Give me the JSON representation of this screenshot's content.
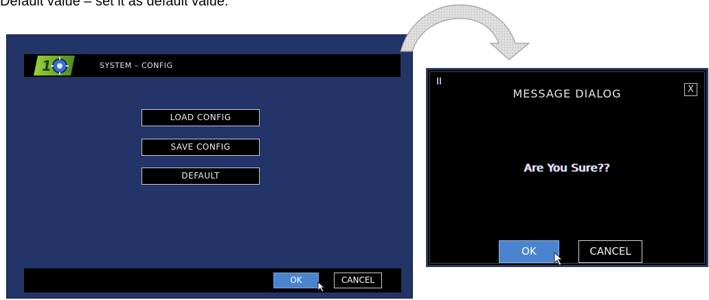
{
  "caption": "Default value – set it as default value.",
  "system_panel": {
    "title": "SYSTEM  –  CONFIG",
    "buttons": {
      "load": "LOAD CONFIG",
      "save": "SAVE CONFIG",
      "default": "DEFAULT"
    },
    "footer": {
      "ok": "OK",
      "cancel": "CANCEL"
    }
  },
  "dialog": {
    "title": "MESSAGE DIALOG",
    "close": "X",
    "message": "Are You Sure??",
    "ok": "OK",
    "cancel": "CANCEL"
  },
  "colors": {
    "panel_bg": "#223468",
    "ok_button": "#4a84cf",
    "header_bg": "#000000"
  },
  "icons": [
    "system-logo-icon",
    "mouse-cursor-icon",
    "curved-arrow-icon",
    "close-icon",
    "grip-icon"
  ]
}
